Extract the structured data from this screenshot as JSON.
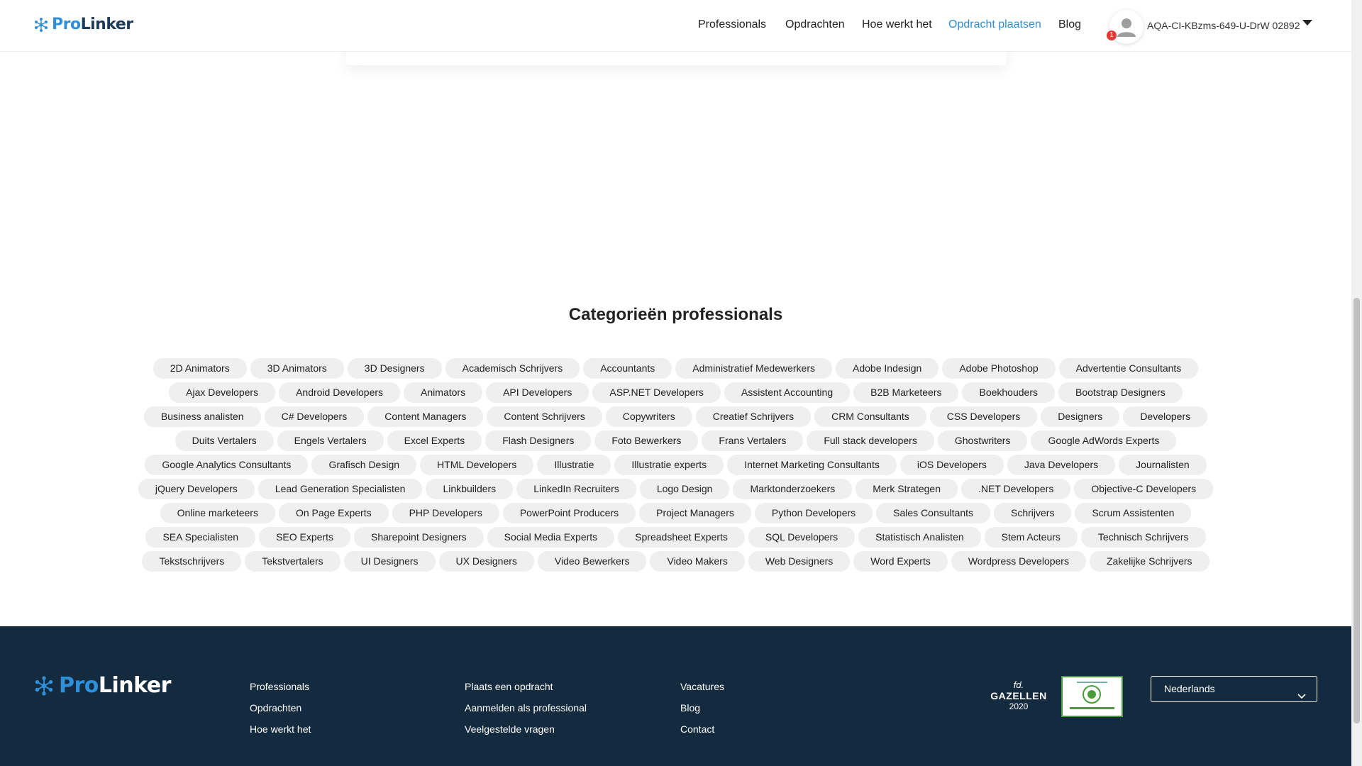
{
  "header": {
    "logo_pro": "Pro",
    "logo_linker": "Linker",
    "nav": [
      "Professionals",
      "Opdrachten",
      "Hoe werkt het",
      "Opdracht plaatsen",
      "Blog"
    ],
    "username": "AQA-CI-KBzms-649-U-DrW 02892",
    "notification_count": "1"
  },
  "categories": {
    "title": "Categorieën professionals",
    "rows": [
      [
        "2D Animators",
        "3D Animators",
        "3D Designers",
        "Academisch Schrijvers",
        "Accountants",
        "Administratief Medewerkers",
        "Adobe Indesign",
        "Adobe Photoshop",
        "Advertentie Consultants"
      ],
      [
        "Ajax Developers",
        "Android Developers",
        "Animators",
        "API Developers",
        "ASP.NET Developers",
        "Assistent Accounting",
        "B2B Marketeers",
        "Boekhouders",
        "Bootstrap Designers"
      ],
      [
        "Business analisten",
        "C# Developers",
        "Content Managers",
        "Content Schrijvers",
        "Copywriters",
        "Creatief Schrijvers",
        "CRM Consultants",
        "CSS Developers",
        "Designers",
        "Developers"
      ],
      [
        "Duits Vertalers",
        "Engels Vertalers",
        "Excel Experts",
        "Flash Designers",
        "Foto Bewerkers",
        "Frans Vertalers",
        "Full stack developers",
        "Ghostwriters",
        "Google AdWords Experts"
      ],
      [
        "Google Analytics Consultants",
        "Grafisch Design",
        "HTML Developers",
        "Illustratie",
        "Illustratie experts",
        "Internet Marketing Consultants",
        "iOS Developers",
        "Java Developers",
        "Journalisten"
      ],
      [
        "jQuery Developers",
        "Lead Generation Specialisten",
        "Linkbuilders",
        "LinkedIn Recruiters",
        "Logo Design",
        "Marktonderzoekers",
        "Merk Strategen",
        ".NET Developers",
        "Objective-C Developers"
      ],
      [
        "Online marketeers",
        "On Page Experts",
        "PHP Developers",
        "PowerPoint Producers",
        "Project Managers",
        "Python Developers",
        "Sales Consultants",
        "Schrijvers",
        "Scrum Assistenten"
      ],
      [
        "SEA Specialisten",
        "SEO Experts",
        "Sharepoint Designers",
        "Social Media Experts",
        "Spreadsheet Experts",
        "SQL Developers",
        "Statistisch Analisten",
        "Stem Acteurs",
        "Technisch Schrijvers"
      ],
      [
        "Tekstschrijvers",
        "Tekstvertalers",
        "UI Designers",
        "UX Designers",
        "Video Bewerkers",
        "Video Makers",
        "Web Designers",
        "Word Experts",
        "Wordpress Developers",
        "Zakelijke Schrijvers"
      ]
    ]
  },
  "footer": {
    "logo_pro": "Pro",
    "logo_linker": "Linker",
    "col1": [
      "Professionals",
      "Opdrachten",
      "Hoe werkt het"
    ],
    "col2": [
      "Plaats een opdracht",
      "Aanmelden als professional",
      "Veelgestelde vragen"
    ],
    "col3": [
      "Vacatures",
      "Blog",
      "Contact"
    ],
    "gazellen_fd": "fd.",
    "gazellen_label": "GAZELLEN",
    "gazellen_year": "2020",
    "language": "Nederlands"
  },
  "colors": {
    "accent": "#2f8fd8",
    "footer_bg": "#142b3f",
    "tag_bg": "#efefef"
  }
}
